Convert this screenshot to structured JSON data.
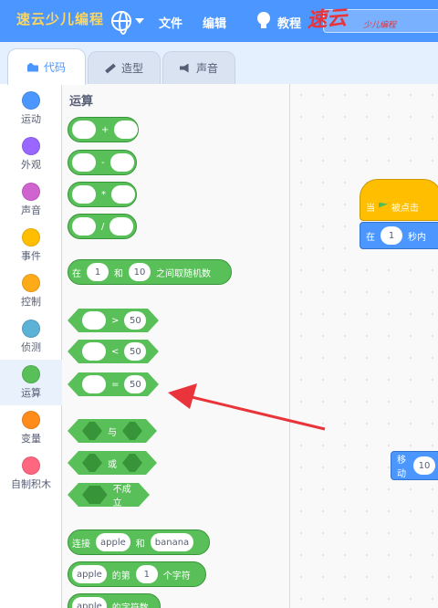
{
  "menubar": {
    "logo": "速云少儿编程",
    "file": "文件",
    "edit": "编辑",
    "tutorials": "教程",
    "search_placeholder": "",
    "watermark": "速云",
    "watermark_sub": "少儿编程"
  },
  "tabs": [
    {
      "label": "代码",
      "active": true
    },
    {
      "label": "造型",
      "active": false
    },
    {
      "label": "声音",
      "active": false
    }
  ],
  "categories": [
    {
      "label": "运动",
      "color": "#4c97ff"
    },
    {
      "label": "外观",
      "color": "#9966ff"
    },
    {
      "label": "声音",
      "color": "#cf63cf"
    },
    {
      "label": "事件",
      "color": "#ffbf00"
    },
    {
      "label": "控制",
      "color": "#ffab19"
    },
    {
      "label": "侦测",
      "color": "#5cb1d6"
    },
    {
      "label": "运算",
      "color": "#59c059",
      "selected": true
    },
    {
      "label": "变量",
      "color": "#ff8c1a"
    },
    {
      "label": "自制积木",
      "color": "#ff6680"
    }
  ],
  "palette": {
    "title": "运算",
    "ops": [
      "+",
      "-",
      "*",
      "/"
    ],
    "random": {
      "prefix": "在",
      "from": "1",
      "and": "和",
      "to": "10",
      "suffix": "之间取随机数"
    },
    "compare": [
      {
        "op": ">",
        "value": "50"
      },
      {
        "op": "<",
        "value": "50"
      },
      {
        "op": "=",
        "value": "50"
      }
    ],
    "logic": {
      "and": "与",
      "or": "或",
      "not": "不成立"
    },
    "join": {
      "label": "连接",
      "a": "apple",
      "and": "和",
      "b": "banana"
    },
    "letter": {
      "a": "apple",
      "of": "的第",
      "n": "1",
      "suffix": "个字符"
    },
    "length": {
      "a": "apple",
      "suffix": "的字符数"
    }
  },
  "workspace": {
    "hat_prefix": "当",
    "hat_suffix": "被点击",
    "wait_prefix": "在",
    "wait_value": "1",
    "wait_suffix": "秒内",
    "move_label": "移动",
    "move_value": "10"
  },
  "colors": {
    "menubar": "#4c97ff",
    "operators": "#59c059",
    "annotation_arrow": "#e8343a"
  }
}
